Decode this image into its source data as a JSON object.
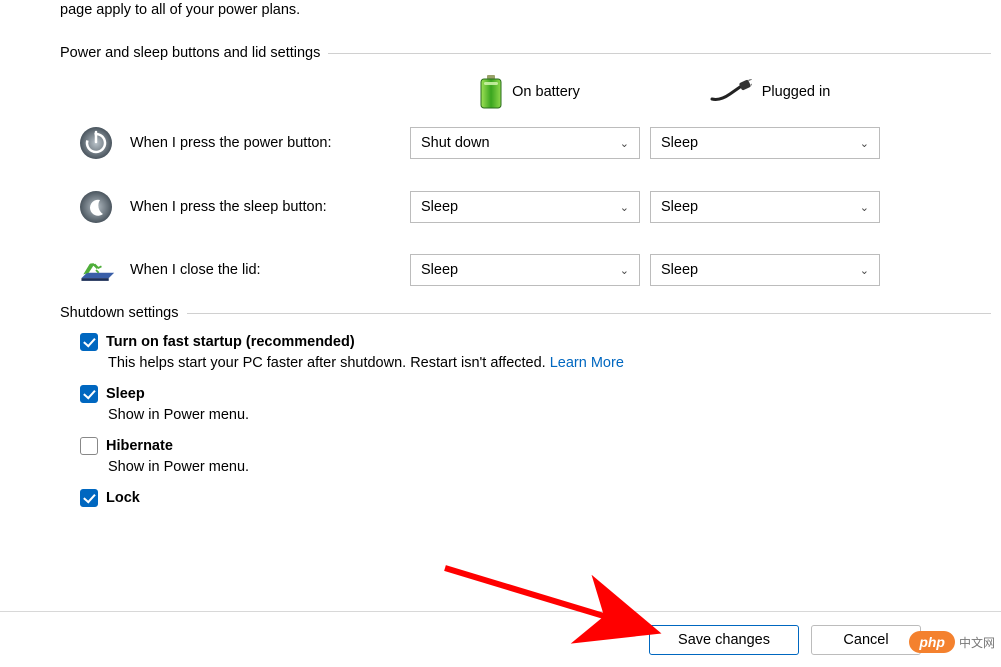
{
  "intro": "page apply to all of your power plans.",
  "sections": {
    "buttons_lid": "Power and sleep buttons and lid settings",
    "shutdown": "Shutdown settings"
  },
  "columns": {
    "battery": "On battery",
    "plugged": "Plugged in"
  },
  "rows": {
    "power_btn": {
      "label": "When I press the power button:",
      "battery": "Shut down",
      "plugged": "Sleep"
    },
    "sleep_btn": {
      "label": "When I press the sleep button:",
      "battery": "Sleep",
      "plugged": "Sleep"
    },
    "lid": {
      "label": "When I close the lid:",
      "battery": "Sleep",
      "plugged": "Sleep"
    }
  },
  "shutdown_items": {
    "fast_startup": {
      "title": "Turn on fast startup (recommended)",
      "desc": "This helps start your PC faster after shutdown. Restart isn't affected. ",
      "link": "Learn More",
      "checked": true
    },
    "sleep": {
      "title": "Sleep",
      "desc": "Show in Power menu.",
      "checked": true
    },
    "hibernate": {
      "title": "Hibernate",
      "desc": "Show in Power menu.",
      "checked": false
    },
    "lock": {
      "title": "Lock",
      "checked": true
    }
  },
  "buttons": {
    "save": "Save changes",
    "cancel": "Cancel"
  },
  "watermark": {
    "badge": "php",
    "text": "中文网"
  }
}
